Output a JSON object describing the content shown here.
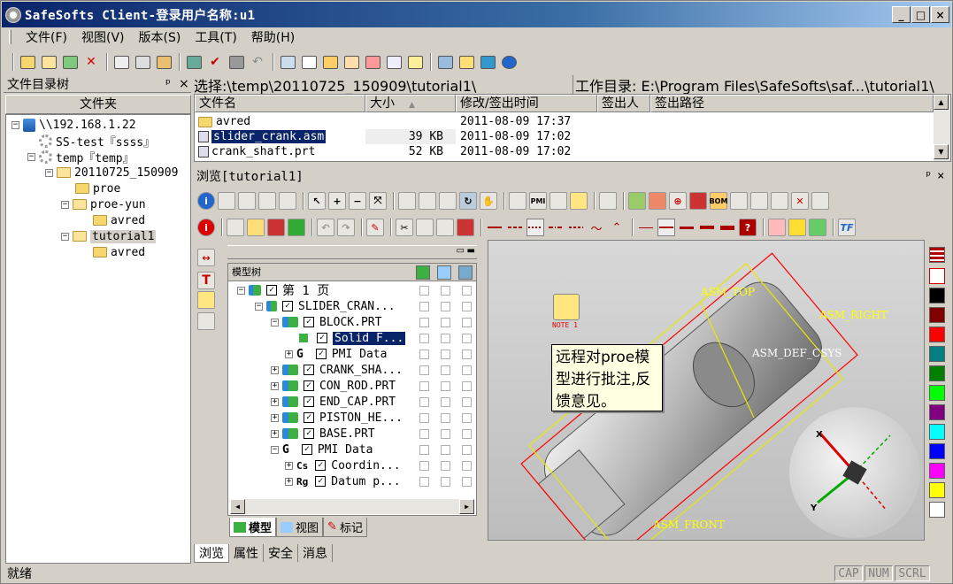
{
  "window": {
    "title": "SafeSofts Client-登录用户名称:u1",
    "btn_min": "_",
    "btn_max": "□",
    "btn_close": "×"
  },
  "menu": [
    "文件(F)",
    "视图(V)",
    "版本(S)",
    "工具(T)",
    "帮助(H)"
  ],
  "left_panel": {
    "title": "文件目录树",
    "pin": "ᵖ",
    "close": "×",
    "column": "文件夹",
    "tree": [
      "\\\\192.168.1.22",
      "SS-test『ssss』",
      "temp『temp』",
      "20110725_150909",
      "proe",
      "proe-yun",
      "avred",
      "tutorial1",
      "avred"
    ]
  },
  "path": {
    "label": "选择:\\temp\\20110725_150909\\tutorial1\\",
    "workdir": "工作目录: E:\\Program Files\\SafeSofts\\saf...\\tutorial1\\"
  },
  "files": {
    "headers": [
      "文件名",
      "大小",
      "修改/签出时间",
      "签出人",
      "签出路径"
    ],
    "rows": [
      {
        "name": "avred",
        "size": "",
        "time": "2011-08-09 17:37"
      },
      {
        "name": "slider_crank.asm",
        "size": "39 KB",
        "time": "2011-08-09 17:02"
      },
      {
        "name": "crank_shaft.prt",
        "size": "52 KB",
        "time": "2011-08-09 17:02"
      }
    ]
  },
  "browse": {
    "title": "浏览[tutorial1]",
    "pin": "ᵖ",
    "close": "×"
  },
  "model_tree": {
    "header": "模型树",
    "rows": [
      "第 1 页",
      "SLIDER_CRAN...",
      "BLOCK.PRT",
      "Solid F...",
      "PMI Data",
      "CRANK_SHA...",
      "CON_ROD.PRT",
      "END_CAP.PRT",
      "PISTON_HE...",
      "BASE.PRT",
      "PMI Data",
      "Coordin...",
      "Datum p..."
    ],
    "prefix_g": "G",
    "prefix_cs": "Cs",
    "prefix_rg": "Rg",
    "tabs": [
      "模型",
      "视图",
      "标记"
    ]
  },
  "viewer": {
    "note_label": "NOTE 1",
    "callout": "远程对proe模型进行批注,反馈意见。",
    "labels": [
      "ASM_TOP",
      "ASM_RIGHT",
      "ASM_DEF_CSYS",
      "ASM_FRONT"
    ],
    "axis_x": "X",
    "axis_y": "Y"
  },
  "palette_colors": [
    "#000000",
    "#800000",
    "#ff0000",
    "#008080",
    "#008000",
    "#00ff00",
    "#800080",
    "#00ffff",
    "#0000ff",
    "#ff00ff",
    "#ffff00",
    "#ffffff"
  ],
  "bottom_tabs": [
    "浏览",
    "属性",
    "安全",
    "消息"
  ],
  "status": {
    "text": "就绪",
    "cap": "CAP",
    "num": "NUM",
    "scrl": "SCRL"
  }
}
